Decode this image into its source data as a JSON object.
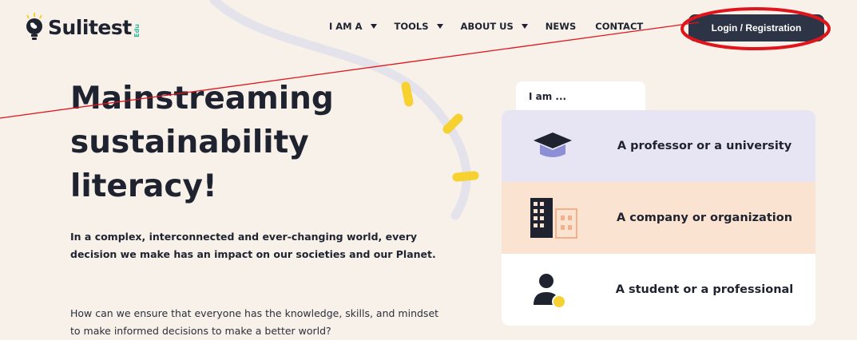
{
  "brand": {
    "name": "Sulitest",
    "suffix": "Edu"
  },
  "nav": {
    "items": [
      {
        "label": "I AM A",
        "dropdown": true
      },
      {
        "label": "TOOLS",
        "dropdown": true
      },
      {
        "label": "ABOUT US",
        "dropdown": true
      },
      {
        "label": "NEWS",
        "dropdown": false
      },
      {
        "label": "CONTACT",
        "dropdown": false
      }
    ],
    "login_label": "Login / Registration"
  },
  "hero": {
    "title_lines": [
      "Mainstreaming",
      "sustainability",
      "literacy!"
    ],
    "paragraph1": "In a complex, interconnected and ever-changing world, every decision we make has an impact on our societies and our Planet.",
    "paragraph2": "How can we ensure that everyone has the knowledge, skills, and mindset to make informed decisions to make a better world?"
  },
  "selector": {
    "tab_label": "I am ...",
    "options": [
      {
        "label": "A professor or a university",
        "icon": "graduation-cap-icon"
      },
      {
        "label": "A company or organization",
        "icon": "building-icon"
      },
      {
        "label": "A student or a professional",
        "icon": "person-icon"
      }
    ]
  },
  "colors": {
    "primary_dark": "#2d3445",
    "background": "#f8f1ea",
    "option_university": "#e7e5f4",
    "option_company": "#fbe3d2",
    "accent_yellow": "#f6d12f",
    "annotation_red": "#e0141b"
  }
}
